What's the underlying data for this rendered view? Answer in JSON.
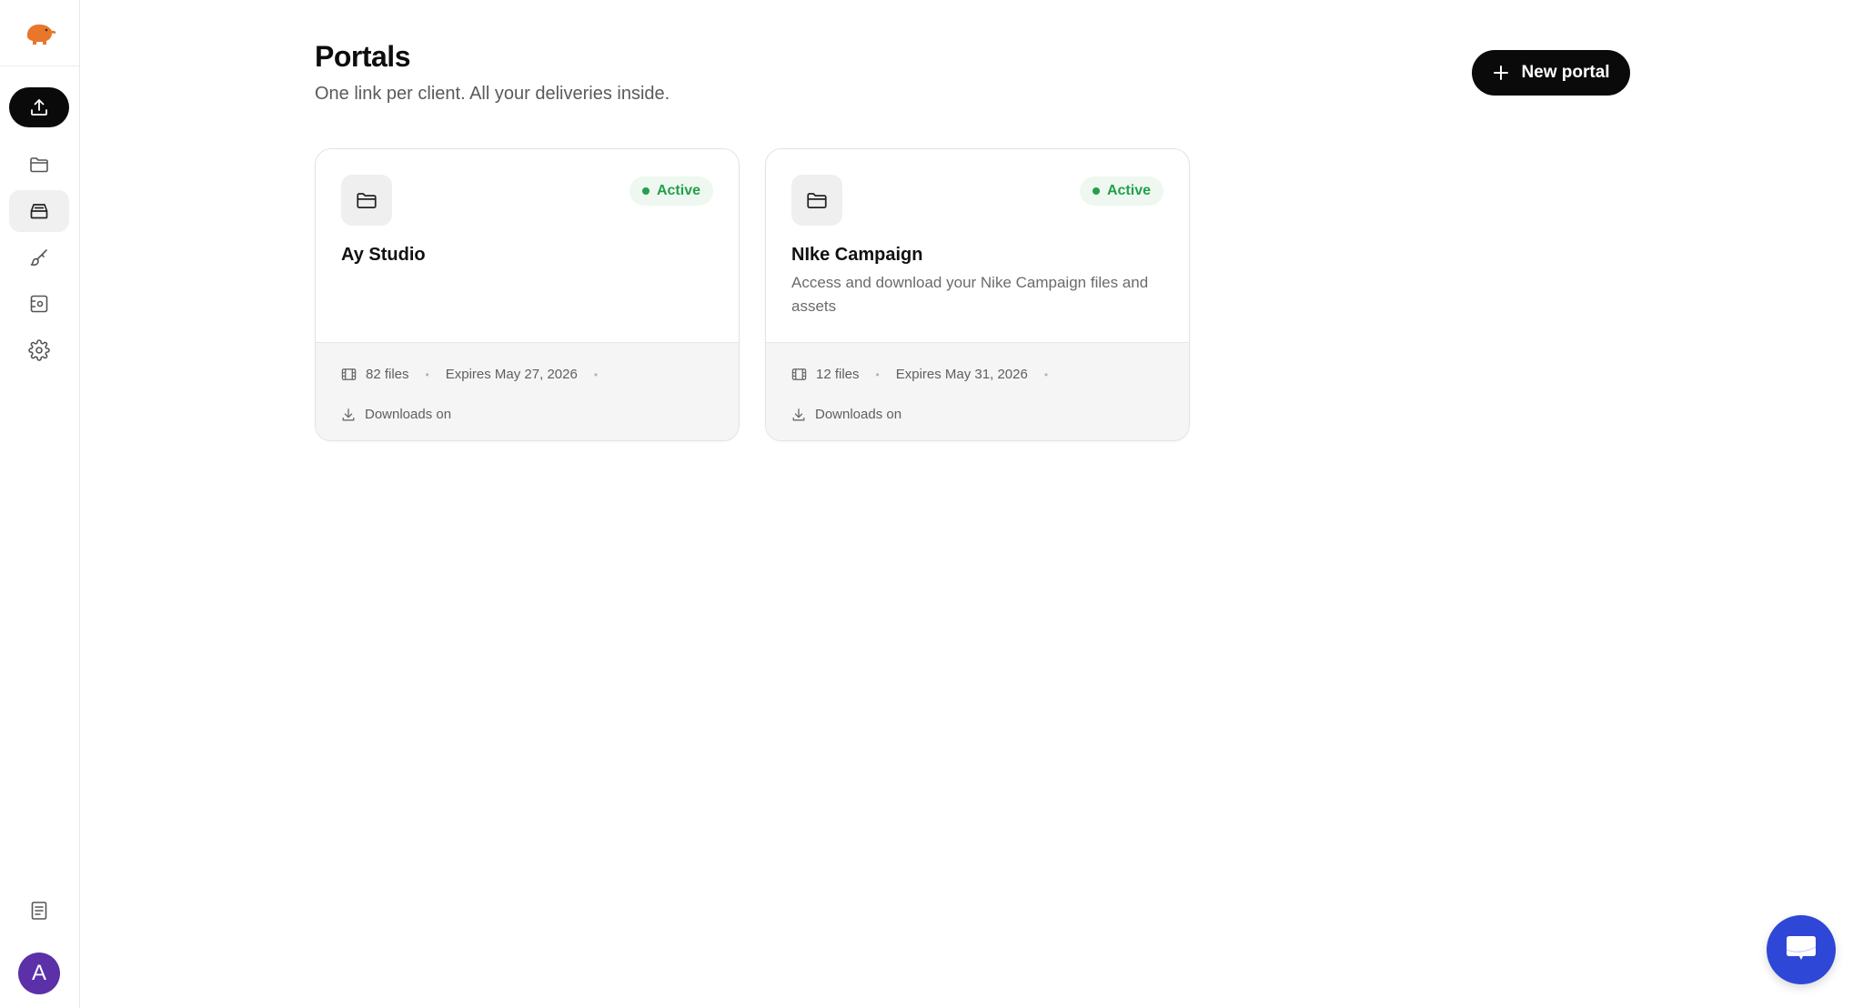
{
  "app": {
    "logo_icon": "elephant-logo-icon",
    "accent_color": "#0a0a0a",
    "brand_color": "#e8762b"
  },
  "sidebar": {
    "upload_icon": "upload-icon",
    "items": [
      {
        "name": "files",
        "icon": "folder-icon",
        "active": false
      },
      {
        "name": "portals",
        "icon": "inbox-tray-icon",
        "active": true
      },
      {
        "name": "brand",
        "icon": "brush-icon",
        "active": false
      },
      {
        "name": "capture",
        "icon": "screenshot-icon",
        "active": false
      },
      {
        "name": "settings",
        "icon": "gear-icon",
        "active": false
      }
    ],
    "docs_icon": "document-icon",
    "avatar_initial": "A",
    "avatar_color": "#5b30a8"
  },
  "header": {
    "title": "Portals",
    "subtitle": "One link per client. All your deliveries inside.",
    "new_portal_label": "New portal"
  },
  "portals": [
    {
      "name": "Ay Studio",
      "description": "",
      "status": "Active",
      "files": "82 files",
      "expires": "Expires May 27, 2026",
      "downloads": "Downloads on"
    },
    {
      "name": "NIke Campaign",
      "description": "Access and download your Nike Campaign files and assets",
      "status": "Active",
      "files": "12 files",
      "expires": "Expires May 31, 2026",
      "downloads": "Downloads on"
    }
  ],
  "status_color": "#23a04a",
  "chat": {
    "icon": "chat-bubble-icon",
    "color": "#2f47d6"
  }
}
